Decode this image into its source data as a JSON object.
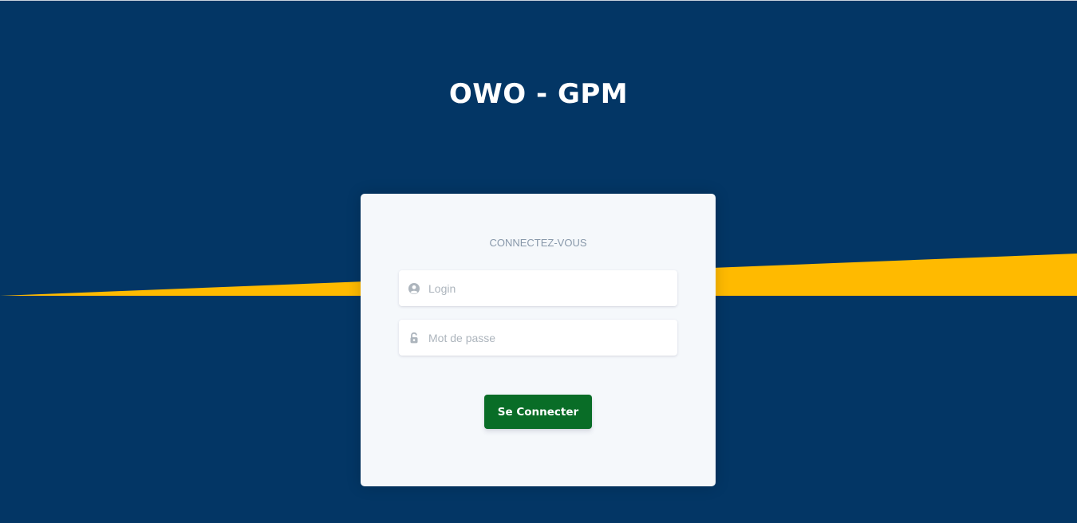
{
  "app": {
    "title": "OWO - GPM"
  },
  "colors": {
    "background": "#033665",
    "stripe": "#FFBA00",
    "card": "#F5F8FB",
    "button": "#096D27"
  },
  "login_card": {
    "heading": "CONNECTEZ-VOUS",
    "login_field": {
      "placeholder": "Login",
      "value": "",
      "icon": "user-circle-icon"
    },
    "password_field": {
      "placeholder": "Mot de passe",
      "value": "",
      "icon": "unlock-icon"
    },
    "submit_label": "Se Connecter"
  }
}
